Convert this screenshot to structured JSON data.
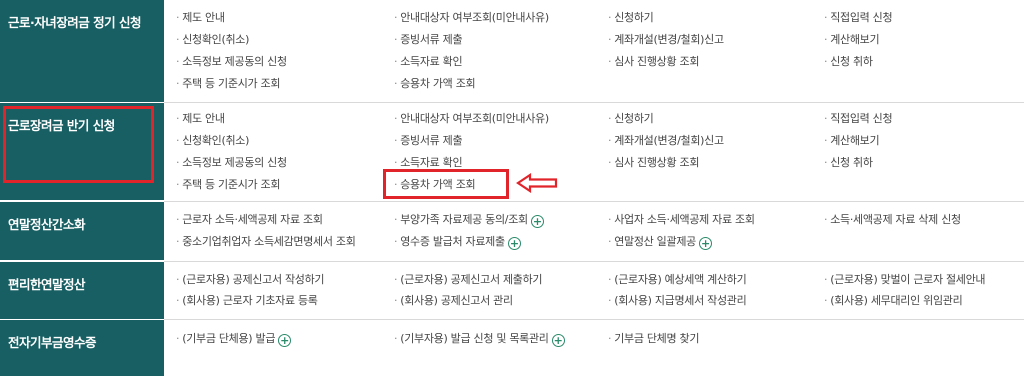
{
  "rows": [
    {
      "category": "근로·자녀장려금 정기 신청",
      "items": [
        [
          "제도 안내",
          "안내대상자 여부조회(미안내사유)",
          "신청하기",
          "직접입력 신청"
        ],
        [
          "신청확인(취소)",
          "증빙서류 제출",
          "계좌개설(변경/철회)신고",
          "계산해보기"
        ],
        [
          "소득정보 제공동의 신청",
          "소득자료 확인",
          "심사 진행상황 조회",
          "신청 취하"
        ],
        [
          "주택 등 기준시가 조회",
          "승용차 가액 조회",
          "",
          ""
        ]
      ]
    },
    {
      "category": "근로장려금 반기 신청",
      "items": [
        [
          "제도 안내",
          "안내대상자 여부조회(미안내사유)",
          "신청하기",
          "직접입력 신청"
        ],
        [
          "신청확인(취소)",
          "증빙서류 제출",
          "계좌개설(변경/철회)신고",
          "계산해보기"
        ],
        [
          "소득정보 제공동의 신청",
          "소득자료 확인",
          "심사 진행상황 조회",
          "신청 취하"
        ],
        [
          "주택 등 기준시가 조회",
          "승용차 가액 조회",
          "",
          ""
        ]
      ]
    },
    {
      "category": "연말정산간소화",
      "items": [
        [
          "근로자 소득·세액공제 자료 조회",
          "부양가족 자료제공 동의/조회",
          "사업자 소득·세액공제 자료 조회",
          "소득·세액공제 자료 삭제 신청"
        ],
        [
          "중소기업취업자 소득세감면명세서 조회",
          "영수증 발급처 자료제출",
          "연말정산 일괄제공",
          ""
        ]
      ]
    },
    {
      "category": "편리한연말정산",
      "items": [
        [
          "(근로자용) 공제신고서 작성하기",
          "(근로자용) 공제신고서 제출하기",
          "(근로자용) 예상세액 계산하기",
          "(근로자용) 맞벌이 근로자 절세안내"
        ],
        [
          "(회사용) 근로자 기초자료 등록",
          "(회사용) 공제신고서 관리",
          "(회사용) 지급명세서 작성관리",
          "(회사용) 세무대리인 위임관리"
        ]
      ]
    },
    {
      "category": "전자기부금영수증",
      "items": [
        [
          "(기부금 단체용) 발급",
          "(기부자용) 발급 신청 및 목록관리",
          "기부금 단체명 찾기",
          ""
        ]
      ]
    }
  ],
  "plus_symbol": "+",
  "item_bullet": "·",
  "colors": {
    "category_bg": "#175f63",
    "highlight": "#e0242a",
    "plus": "#2a8a6a"
  }
}
